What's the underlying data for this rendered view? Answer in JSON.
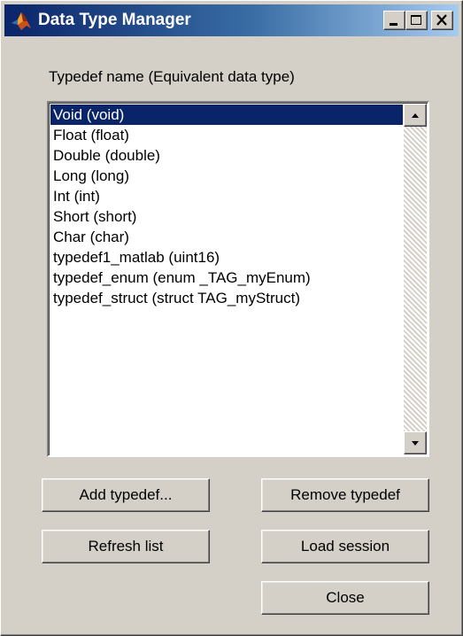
{
  "window": {
    "title": "Data Type Manager",
    "icon": "matlab-logo-icon",
    "controls": {
      "minimize_icon": "minimize-icon",
      "maximize_icon": "maximize-icon",
      "close_icon": "close-icon"
    }
  },
  "list": {
    "header": "Typedef name (Equivalent data type)",
    "selected_index": 0,
    "items": [
      "Void (void)",
      "Float (float)",
      "Double (double)",
      "Long (long)",
      "Int (int)",
      "Short (short)",
      "Char (char)",
      "typedef1_matlab (uint16)",
      "typedef_enum (enum _TAG_myEnum)",
      "typedef_struct (struct TAG_myStruct)"
    ]
  },
  "buttons": {
    "add_typedef": "Add typedef...",
    "remove_typedef": "Remove typedef",
    "refresh_list": "Refresh list",
    "load_session": "Load session",
    "close": "Close"
  },
  "colors": {
    "window_face": "#d4d0c8",
    "title_bar_start": "#0a246a",
    "title_bar_end": "#a6caf0",
    "selection": "#0a246a"
  }
}
